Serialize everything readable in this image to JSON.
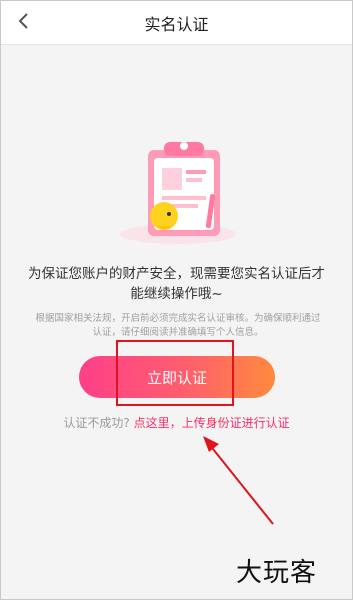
{
  "header": {
    "title": "实名认证",
    "back_icon": "chevron-left-icon"
  },
  "content": {
    "main_text": "为保证您账户的财产安全，现需要您实名认证后才能继续操作哦~",
    "sub_text": "根据国家相关法规，开启前必须完成实名认证审核。为确保顺利通过认证，请仔细阅读并准确填写个人信息。",
    "verify_button": "立即认证",
    "fail_prefix": "认证不成功?",
    "fail_link": "点这里，上传身份证进行认证"
  },
  "colors": {
    "accent_pink": "#ff2d64",
    "button_start": "#ff3f8a",
    "button_end": "#ff8a3c",
    "annotation_red": "#e0141c"
  },
  "watermark": "大玩客"
}
